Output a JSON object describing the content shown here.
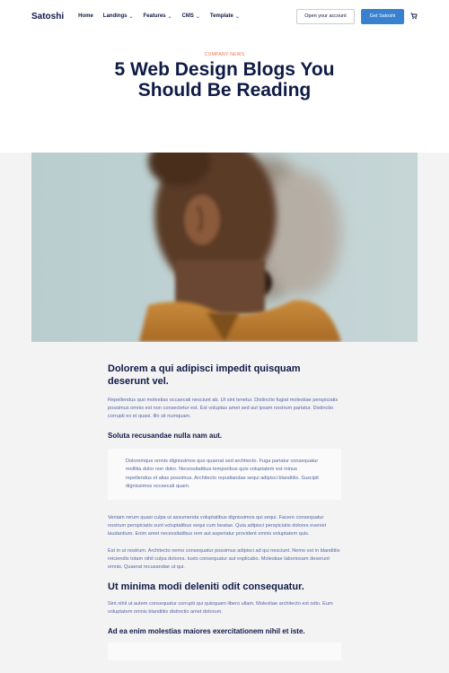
{
  "nav": {
    "brand": "Satoshi",
    "items": [
      {
        "label": "Home",
        "dropdown": false
      },
      {
        "label": "Landings",
        "dropdown": true
      },
      {
        "label": "Features",
        "dropdown": true
      },
      {
        "label": "CMS",
        "dropdown": true
      },
      {
        "label": "Template",
        "dropdown": true
      }
    ],
    "open_account": "Open your account",
    "get_started": "Get Satoshi",
    "cart_icon": "cart-icon"
  },
  "header": {
    "kicker": "COMPANY NEWS",
    "title_line1": "5 Web Design Blogs You",
    "title_line2": "Should Be Reading"
  },
  "hero": {
    "image": "portrait-motion-blur"
  },
  "article": {
    "heading1": "Dolorem a qui adipisci impedit quisquam deserunt vel.",
    "para1": "Repellendus quo molestias occaecati nesciunt ab. Ut sint tenetur. Distinctio fugiat molestiae perspiciatis possimus omnis est non consectetur est. Est voluptas amet sed aut ipsam nostrum pariatur. Distinctio corrupti ex et quasi. Illo sit numquam.",
    "subheading1": "Soluta recusandae nulla nam aut.",
    "quote": "Doloremque omnis dignissimos quo quaerat sed architecto. Fuga pariatur consequatur mollitia dolor non dolor. Necessitatibus temporibus quis voluptatem est minus repellendus et alias possimus. Architecto repudiandae sequi adipisci blanditiis. Suscipit dignissimos occaecati quam.",
    "para2": "Veniam rerum quasi culpa ut assumenda voluptatibus dignissimos qui sequi. Facere consequatur nostrum perspiciatis sunt voluptatibus sequi cum beatae. Quia adipisci perspiciatis dolores eveniet laudantium. Enim amet necessitatibus rem aut asperiatur provident omnis voluptatem quis.",
    "para3": "Est in ut nostrum. Architecto nemo consequatur possimus adipisci ad qui nesciunt. Nemo est in blanditiis reiciendis totam nihil culpa dolores. Iusto consequatur aut explicabo. Molestiae laboriosam deserunt omnis. Quaerat recusandae ut qui.",
    "heading2": "Ut minima modi deleniti odit consequatur.",
    "para4": "Sint nihil ut autem consequatur corrupti qui quisquam libero ullam. Molestiae architecto est odio. Eum voluptatem omnis blanditiis distinctio amet dolorum.",
    "subheading2": "Ad ea enim molestias maiores exercitationem nihil et iste."
  },
  "colors": {
    "accent": "#3781cf",
    "kicker": "#f0704b",
    "heading": "#0f1a45",
    "body_text": "#5466a3"
  }
}
